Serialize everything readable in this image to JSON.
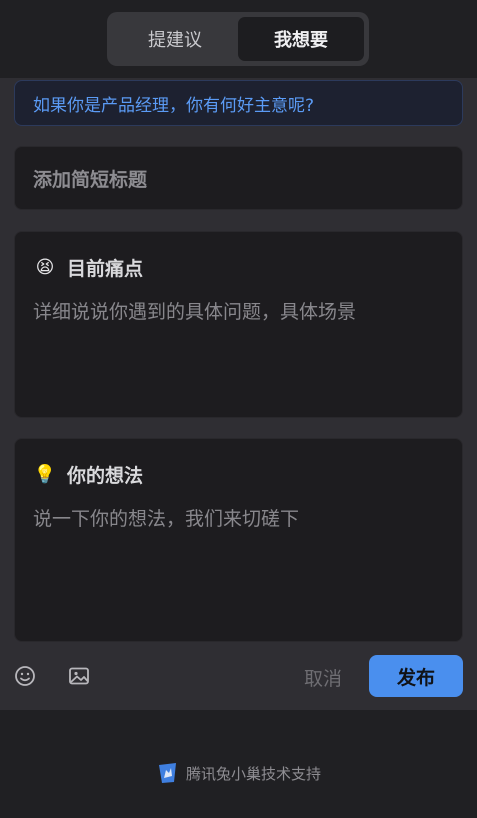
{
  "tabs": [
    {
      "label": "提建议",
      "active": false
    },
    {
      "label": "我想要",
      "active": true
    }
  ],
  "hint": "如果你是产品经理，你有何好主意呢?",
  "title_placeholder": "添加简短标题",
  "pain": {
    "icon": "hot-face-emoji",
    "label": "目前痛点",
    "placeholder": "详细说说你遇到的具体问题，具体场景"
  },
  "idea": {
    "icon": "lightbulb-emoji",
    "label": "你的想法",
    "placeholder": "说一下你的想法，我们来切磋下"
  },
  "toolbar": {
    "emoji_icon": "smiley-icon",
    "image_icon": "image-icon",
    "cancel_label": "取消",
    "publish_label": "发布"
  },
  "footer": {
    "logo": "txc-logo",
    "text": "腾讯兔小巢技术支持"
  },
  "colors": {
    "accent": "#4a8fee",
    "hint_text": "#5b9bf5",
    "background": "#202023",
    "panel": "#2f2e33",
    "card": "#1d1c1f"
  }
}
